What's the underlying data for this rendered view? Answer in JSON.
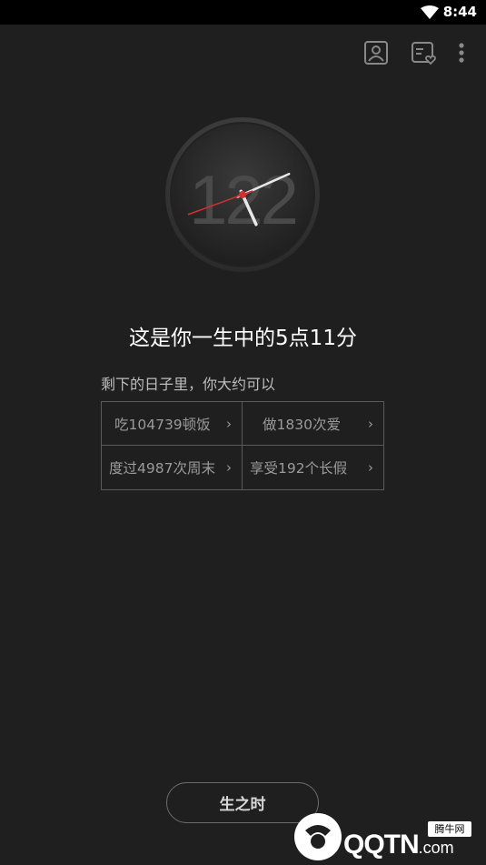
{
  "status_bar": {
    "time": "8:44",
    "wifi_icon": "wifi-icon"
  },
  "toolbar": {
    "icons": [
      "profile-icon",
      "card-heart-icon",
      "more-vert-icon"
    ]
  },
  "clock": {
    "background_number": "122",
    "hour": 5,
    "minute": 11
  },
  "title": "这是你一生中的5点11分",
  "subtitle": "剩下的日子里，你大约可以",
  "grid": [
    {
      "label": "吃104739顿饭",
      "chevron": "›"
    },
    {
      "label": "做1830次爱",
      "chevron": "›"
    },
    {
      "label": "度过4987次周末",
      "chevron": "›"
    },
    {
      "label": "享受192个长假",
      "chevron": "›"
    }
  ],
  "bottom_button": "生之时",
  "watermark": {
    "logo_text": "QQTN",
    "logo_suffix": ".com",
    "badge": "腾牛网"
  },
  "colors": {
    "background": "#1f1f1f",
    "status_bar": "#000000",
    "clock_second_hand": "#d32f2f"
  }
}
